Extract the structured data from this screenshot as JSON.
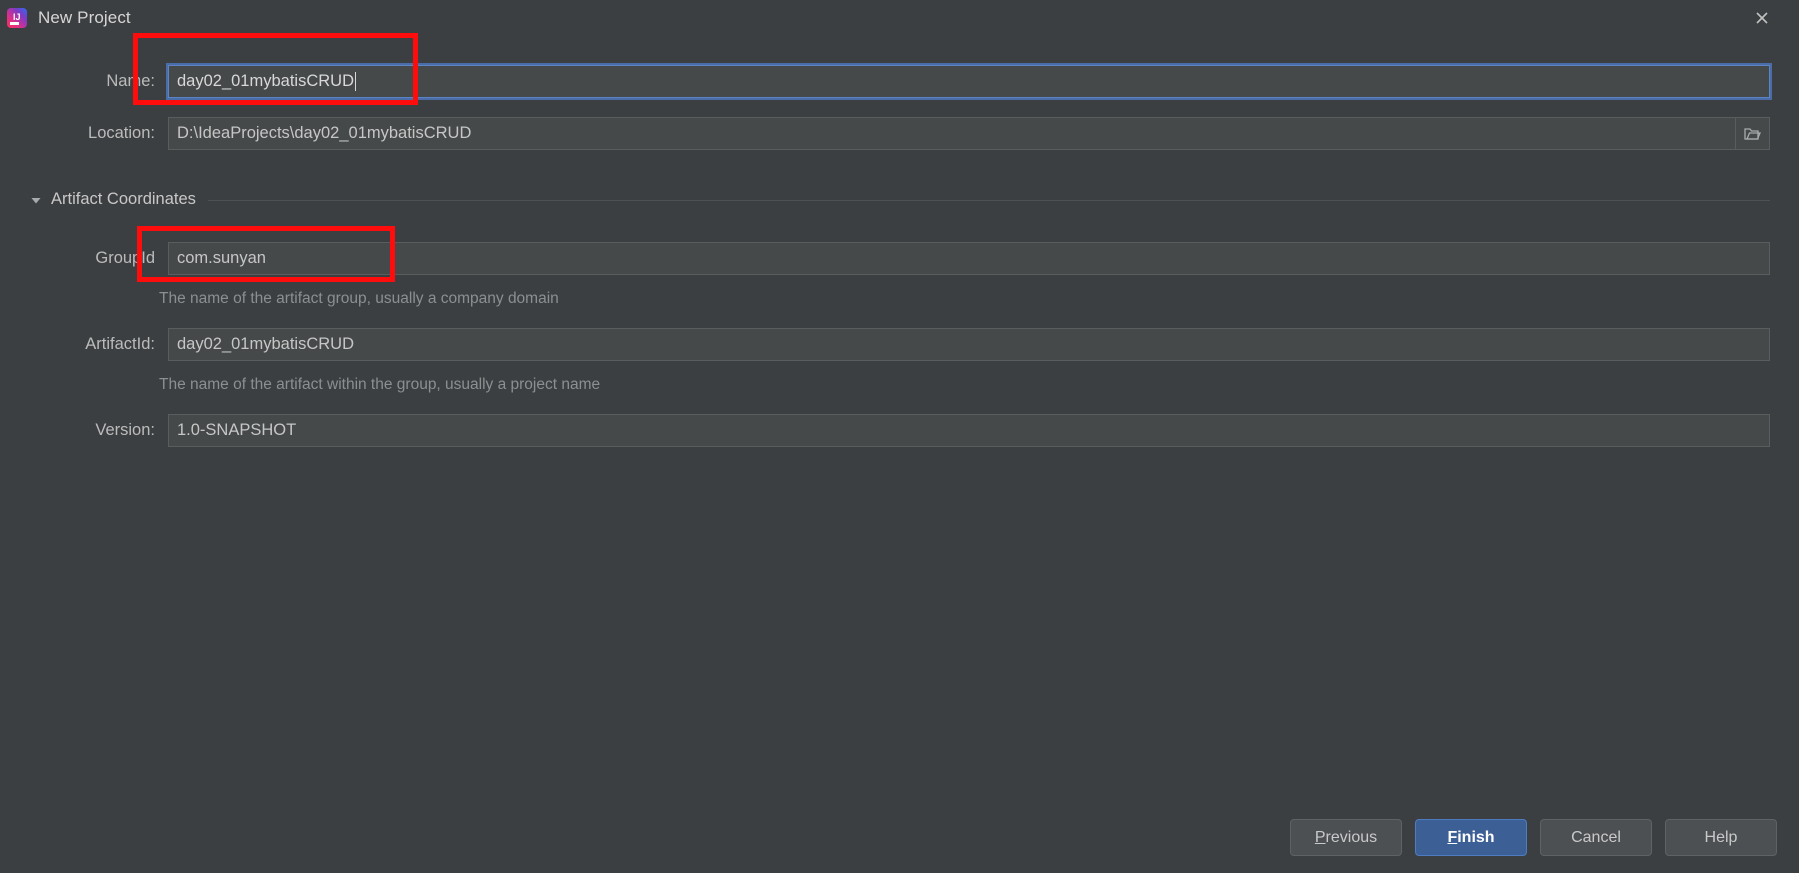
{
  "window": {
    "title": "New Project",
    "app_icon": "intellij-idea-icon",
    "close_icon": "close-icon"
  },
  "form": {
    "name": {
      "label": "Name:",
      "value": "day02_01mybatisCRUD",
      "focused": true
    },
    "location": {
      "label": "Location:",
      "value": "D:\\IdeaProjects\\day02_01mybatisCRUD",
      "browse_icon": "folder-icon"
    }
  },
  "section": {
    "title": "Artifact Coordinates",
    "expanded": true,
    "triangle_icon": "chevron-down-icon",
    "group_id": {
      "label": "GroupId",
      "value": "com.sunyan",
      "helper": "The name of the artifact group, usually a company domain"
    },
    "artifact_id": {
      "label": "ArtifactId:",
      "value": "day02_01mybatisCRUD",
      "helper": "The name of the artifact within the group, usually a project name"
    },
    "version": {
      "label": "Version:",
      "value": "1.0-SNAPSHOT"
    }
  },
  "buttons": {
    "previous": {
      "mnemonic": "P",
      "rest": "revious"
    },
    "finish": {
      "mnemonic": "F",
      "rest": "inish"
    },
    "cancel": {
      "label": "Cancel"
    },
    "help": {
      "label": "Help"
    }
  },
  "colors": {
    "background": "#3c3f41",
    "field_background": "#45494a",
    "primary_button": "#3c6095",
    "focus_border": "#5c84c4",
    "annotation": "#ff0d0d",
    "label_text": "#bbbbbb",
    "helper_text": "#8c8f91"
  }
}
